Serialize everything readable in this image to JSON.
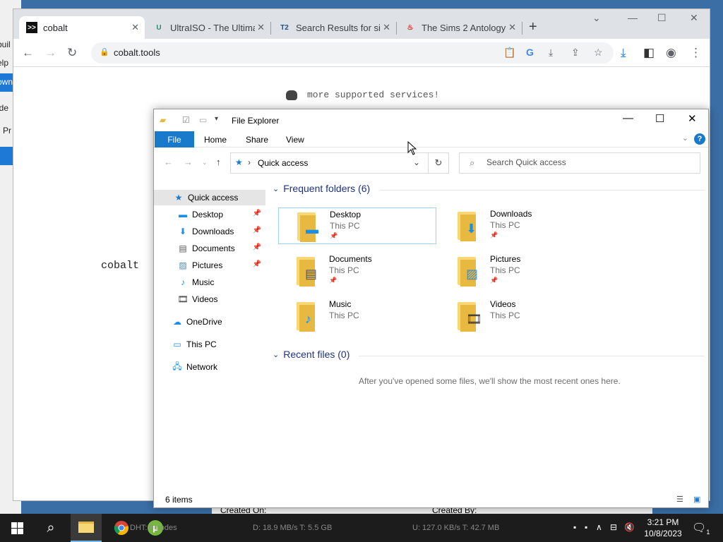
{
  "background_app": {
    "fragments": [
      "buil",
      "elp",
      "own",
      "ide",
      "Pr",
      ")",
      ")"
    ]
  },
  "background_bottom": {
    "created_on": "Created On:",
    "created_by": "Created By:"
  },
  "chrome": {
    "tabs": [
      {
        "title": "cobalt",
        "icon": "terminal-icon"
      },
      {
        "title": "UltraISO - The Ultimate",
        "icon": "ultraiso-icon"
      },
      {
        "title": "Search Results for sims",
        "icon": "t2-icon"
      },
      {
        "title": "The Sims 2 Antology",
        "icon": "fire-icon"
      }
    ],
    "new_tab": "+",
    "url": "cobalt.tools",
    "page": {
      "services_text": "more supported services!",
      "logo_text": "cobalt"
    }
  },
  "explorer": {
    "title": "File Explorer",
    "ribbon_tabs": [
      "File",
      "Home",
      "Share",
      "View"
    ],
    "help": "?",
    "address_path": "Quick access",
    "search_placeholder": "Search Quick access",
    "nav_pane": [
      {
        "label": "Quick access",
        "icon": "star-icon",
        "pinned": false,
        "selected": true
      },
      {
        "label": "Desktop",
        "icon": "desktop-icon",
        "pinned": true
      },
      {
        "label": "Downloads",
        "icon": "download-icon",
        "pinned": true
      },
      {
        "label": "Documents",
        "icon": "document-icon",
        "pinned": true
      },
      {
        "label": "Pictures",
        "icon": "picture-icon",
        "pinned": true
      },
      {
        "label": "Music",
        "icon": "music-icon",
        "pinned": false
      },
      {
        "label": "Videos",
        "icon": "video-icon",
        "pinned": false
      },
      {
        "label": "OneDrive",
        "icon": "cloud-icon",
        "pinned": false
      },
      {
        "label": "This PC",
        "icon": "computer-icon",
        "pinned": false
      },
      {
        "label": "Network",
        "icon": "network-icon",
        "pinned": false
      }
    ],
    "frequent_header": "Frequent folders (6)",
    "folders": [
      {
        "name": "Desktop",
        "location": "This PC",
        "pinned": true
      },
      {
        "name": "Downloads",
        "location": "This PC",
        "pinned": true
      },
      {
        "name": "Documents",
        "location": "This PC",
        "pinned": true
      },
      {
        "name": "Pictures",
        "location": "This PC",
        "pinned": true
      },
      {
        "name": "Music",
        "location": "This PC",
        "pinned": false
      },
      {
        "name": "Videos",
        "location": "This PC",
        "pinned": false
      }
    ],
    "recent_header": "Recent files (0)",
    "recent_empty": "After you've opened some files, we'll show the most recent ones here.",
    "status": "6 items"
  },
  "taskbar": {
    "bg_text_1": "DHT: 0 nodes",
    "bg_text_2": "D: 18.9 MB/s T: 5.5 GB",
    "bg_text_3": "U: 127.0 KB/s T: 42.7 MB",
    "time": "3:21 PM",
    "date": "10/8/2023",
    "notifications": "1"
  },
  "colors": {
    "accent": "#1979ca",
    "folder_yellow": "#f8d775",
    "header_blue": "#1e3287"
  }
}
